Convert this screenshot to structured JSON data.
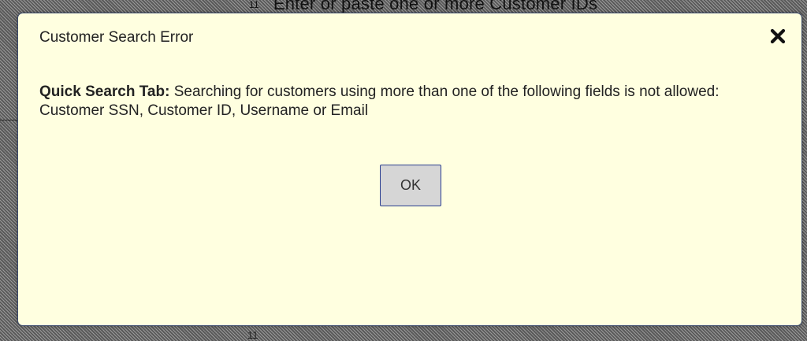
{
  "background": {
    "hint_marker": "11",
    "hint_text": "Enter or paste one or more Customer IDs",
    "bottom_marker": "11"
  },
  "dialog": {
    "title": "Customer Search Error",
    "close_icon": "close-x-icon",
    "message_lead": "Quick Search Tab:",
    "message_body": " Searching for customers using more than one of the following fields is not allowed: Customer SSN, Customer ID, Username or Email",
    "ok_label": "OK"
  },
  "colors": {
    "dialog_background": "#ffffe0",
    "dialog_border": "#3c4b6e",
    "button_background": "#d6d6d6",
    "button_border": "#2b3f8f"
  }
}
